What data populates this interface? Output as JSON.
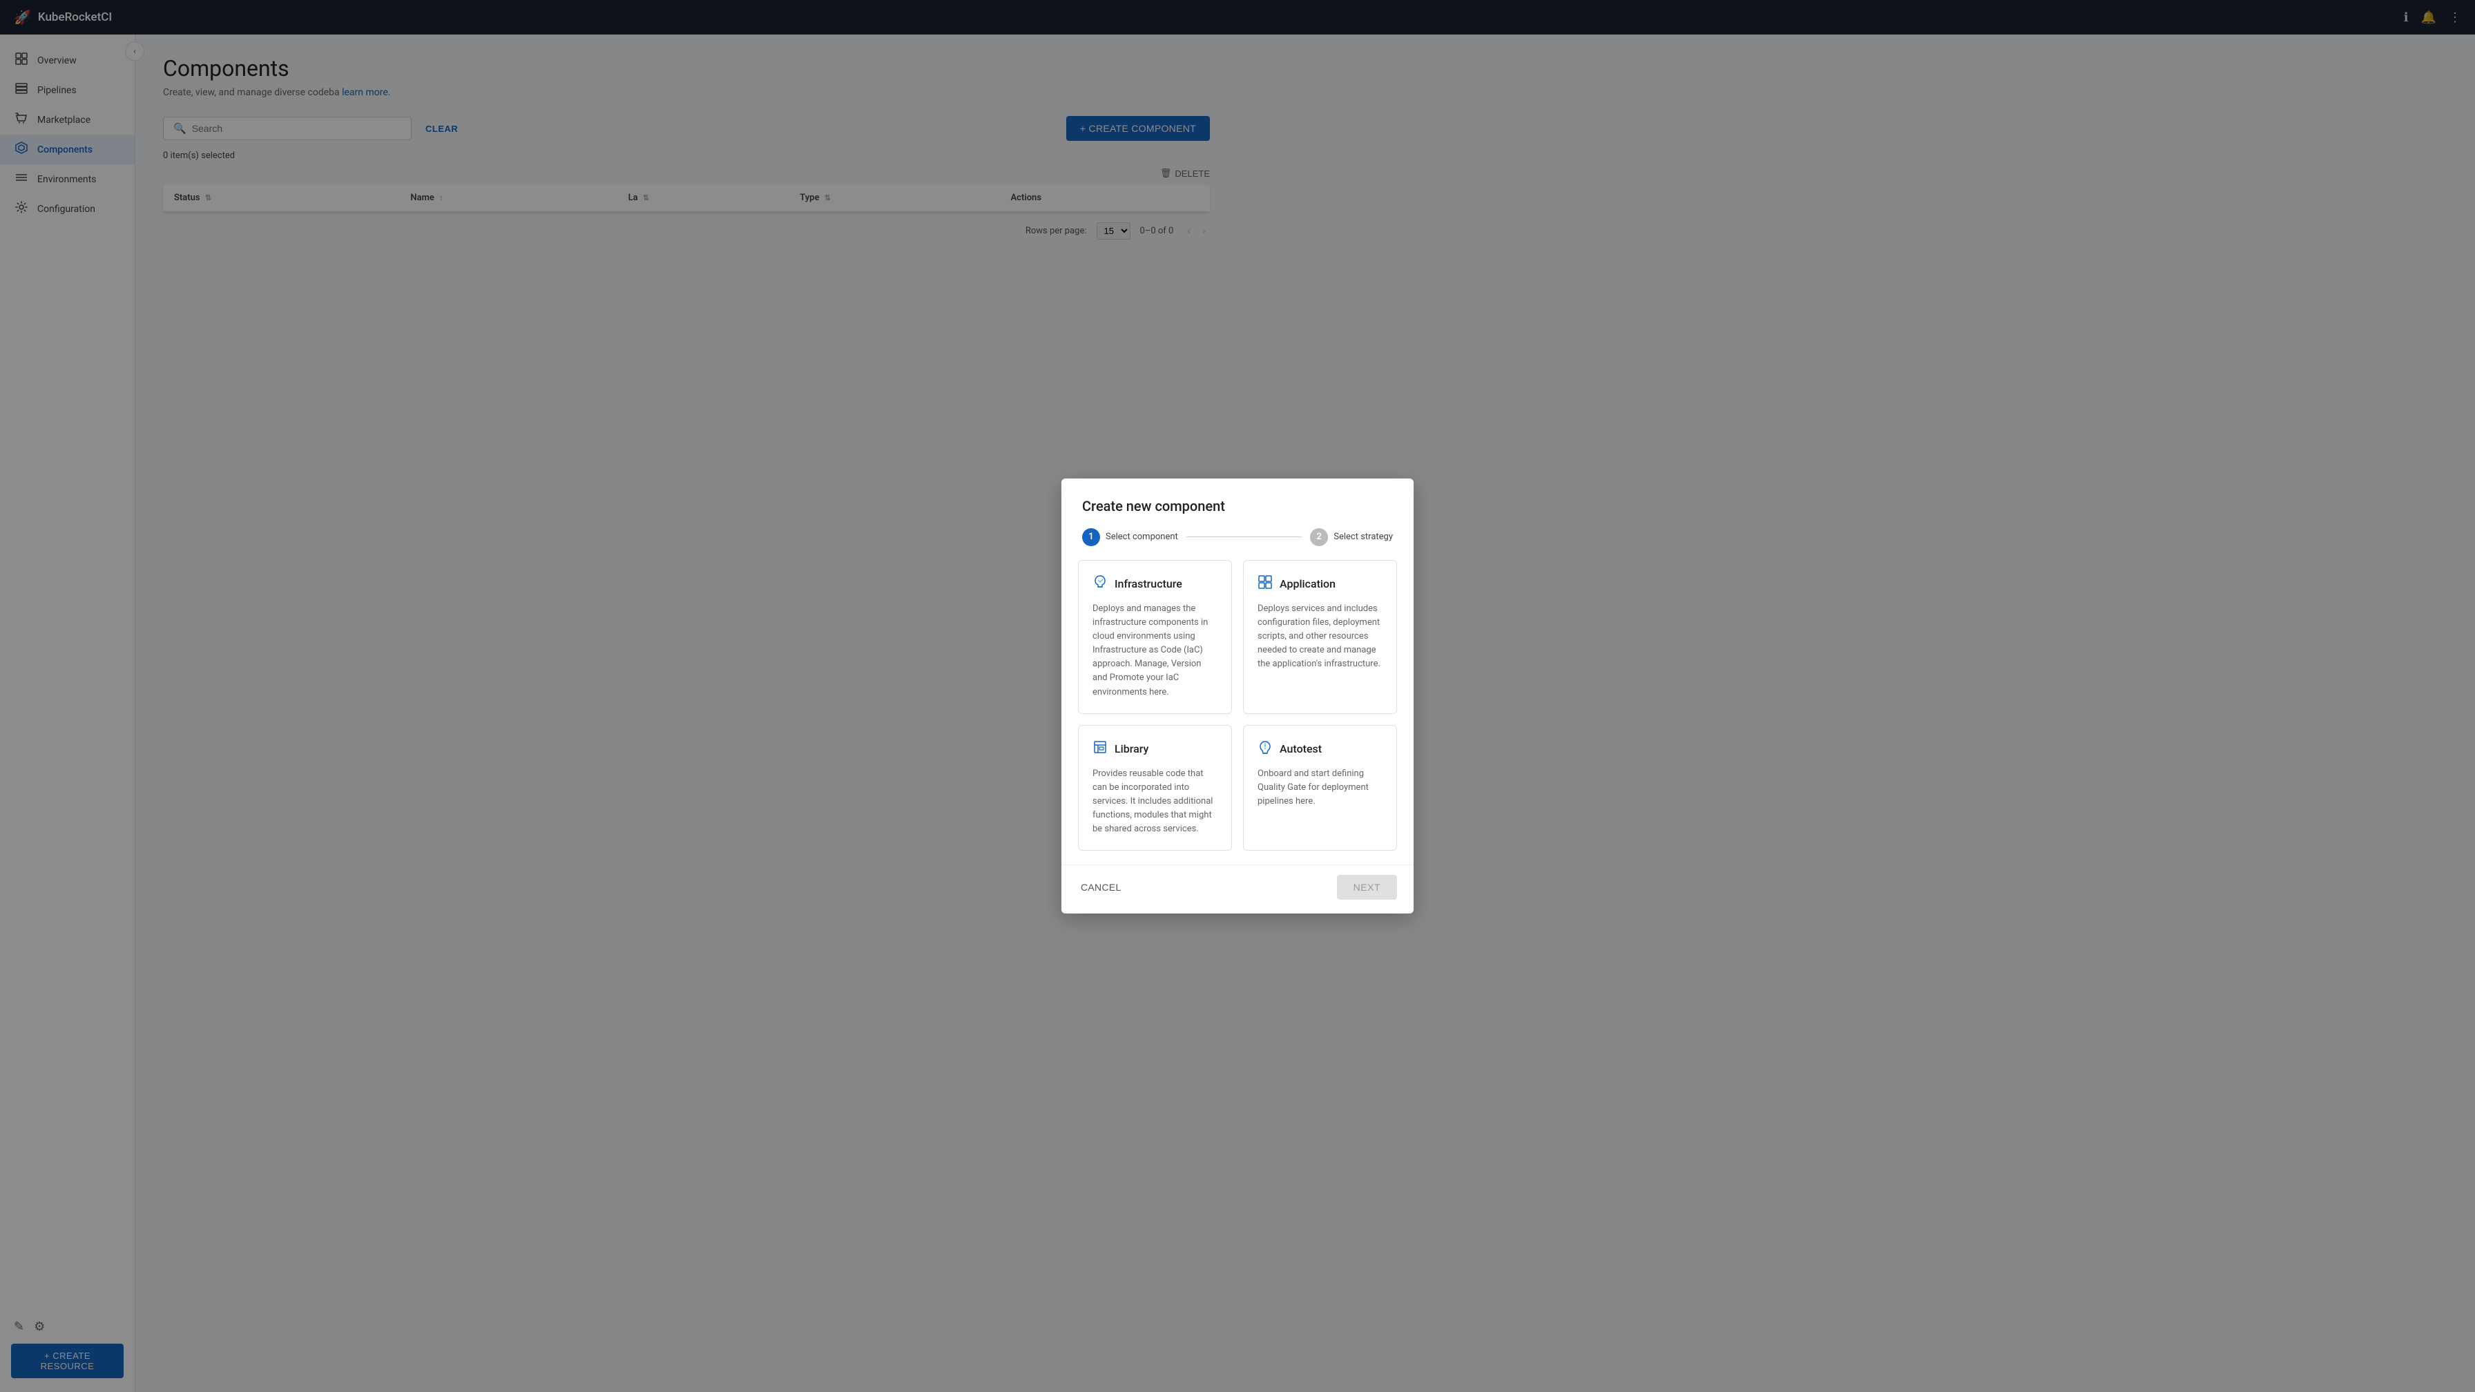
{
  "app": {
    "name": "KubeRocketCI",
    "logo_symbol": "🚀"
  },
  "topnav": {
    "info_icon": "ℹ",
    "bell_icon": "🔔",
    "more_icon": "⋮"
  },
  "sidebar": {
    "collapse_icon": "‹",
    "items": [
      {
        "id": "overview",
        "label": "Overview",
        "icon": "⊞",
        "active": false
      },
      {
        "id": "pipelines",
        "label": "Pipelines",
        "icon": "▦",
        "active": false
      },
      {
        "id": "marketplace",
        "label": "Marketplace",
        "icon": "🛒",
        "active": false
      },
      {
        "id": "components",
        "label": "Components",
        "icon": "◈",
        "active": true
      },
      {
        "id": "environments",
        "label": "Environments",
        "icon": "☰",
        "active": false
      },
      {
        "id": "configuration",
        "label": "Configuration",
        "icon": "⚙",
        "active": false
      }
    ],
    "bottom": {
      "edit_icon": "✎",
      "settings_icon": "⚙",
      "create_resource_label": "+ CREATE RESOURCE"
    }
  },
  "page": {
    "title": "Components",
    "subtitle": "Create, view, and manage diverse codeba",
    "subtitle_link": "learn more."
  },
  "toolbar": {
    "search_placeholder": "Search",
    "clear_label": "CLEAR",
    "create_component_label": "+ CREATE COMPONENT"
  },
  "table": {
    "items_selected_label": "0 item(s) selected",
    "delete_label": "DELETE",
    "columns": [
      {
        "id": "status",
        "label": "Status"
      },
      {
        "id": "name",
        "label": "Name"
      },
      {
        "id": "language",
        "label": "La"
      },
      {
        "id": "type",
        "label": "Type"
      },
      {
        "id": "actions",
        "label": "Actions"
      }
    ],
    "rows": [],
    "pagination": {
      "rows_per_page_label": "Rows per page:",
      "rows_per_page_value": "15",
      "range_label": "0–0 of 0"
    }
  },
  "dialog": {
    "title": "Create new component",
    "step1": {
      "number": "1",
      "label": "Select component",
      "active": true
    },
    "step2": {
      "number": "2",
      "label": "Select strategy",
      "active": false
    },
    "cards": [
      {
        "id": "infrastructure",
        "title": "Infrastructure",
        "icon_label": "infrastructure-icon",
        "description": "Deploys and manages the infrastructure components in cloud environments using Infrastructure as Code (IaC) approach. Manage, Version and Promote your IaC environments here."
      },
      {
        "id": "application",
        "title": "Application",
        "icon_label": "application-icon",
        "description": "Deploys services and includes configuration files, deployment scripts, and other resources needed to create and manage the application's infrastructure."
      },
      {
        "id": "library",
        "title": "Library",
        "icon_label": "library-icon",
        "description": "Provides reusable code that can be incorporated into services. It includes additional functions, modules that might be shared across services."
      },
      {
        "id": "autotest",
        "title": "Autotest",
        "icon_label": "autotest-icon",
        "description": "Onboard and start defining Quality Gate for deployment pipelines here."
      }
    ],
    "cancel_label": "CANCEL",
    "next_label": "NEXT"
  }
}
